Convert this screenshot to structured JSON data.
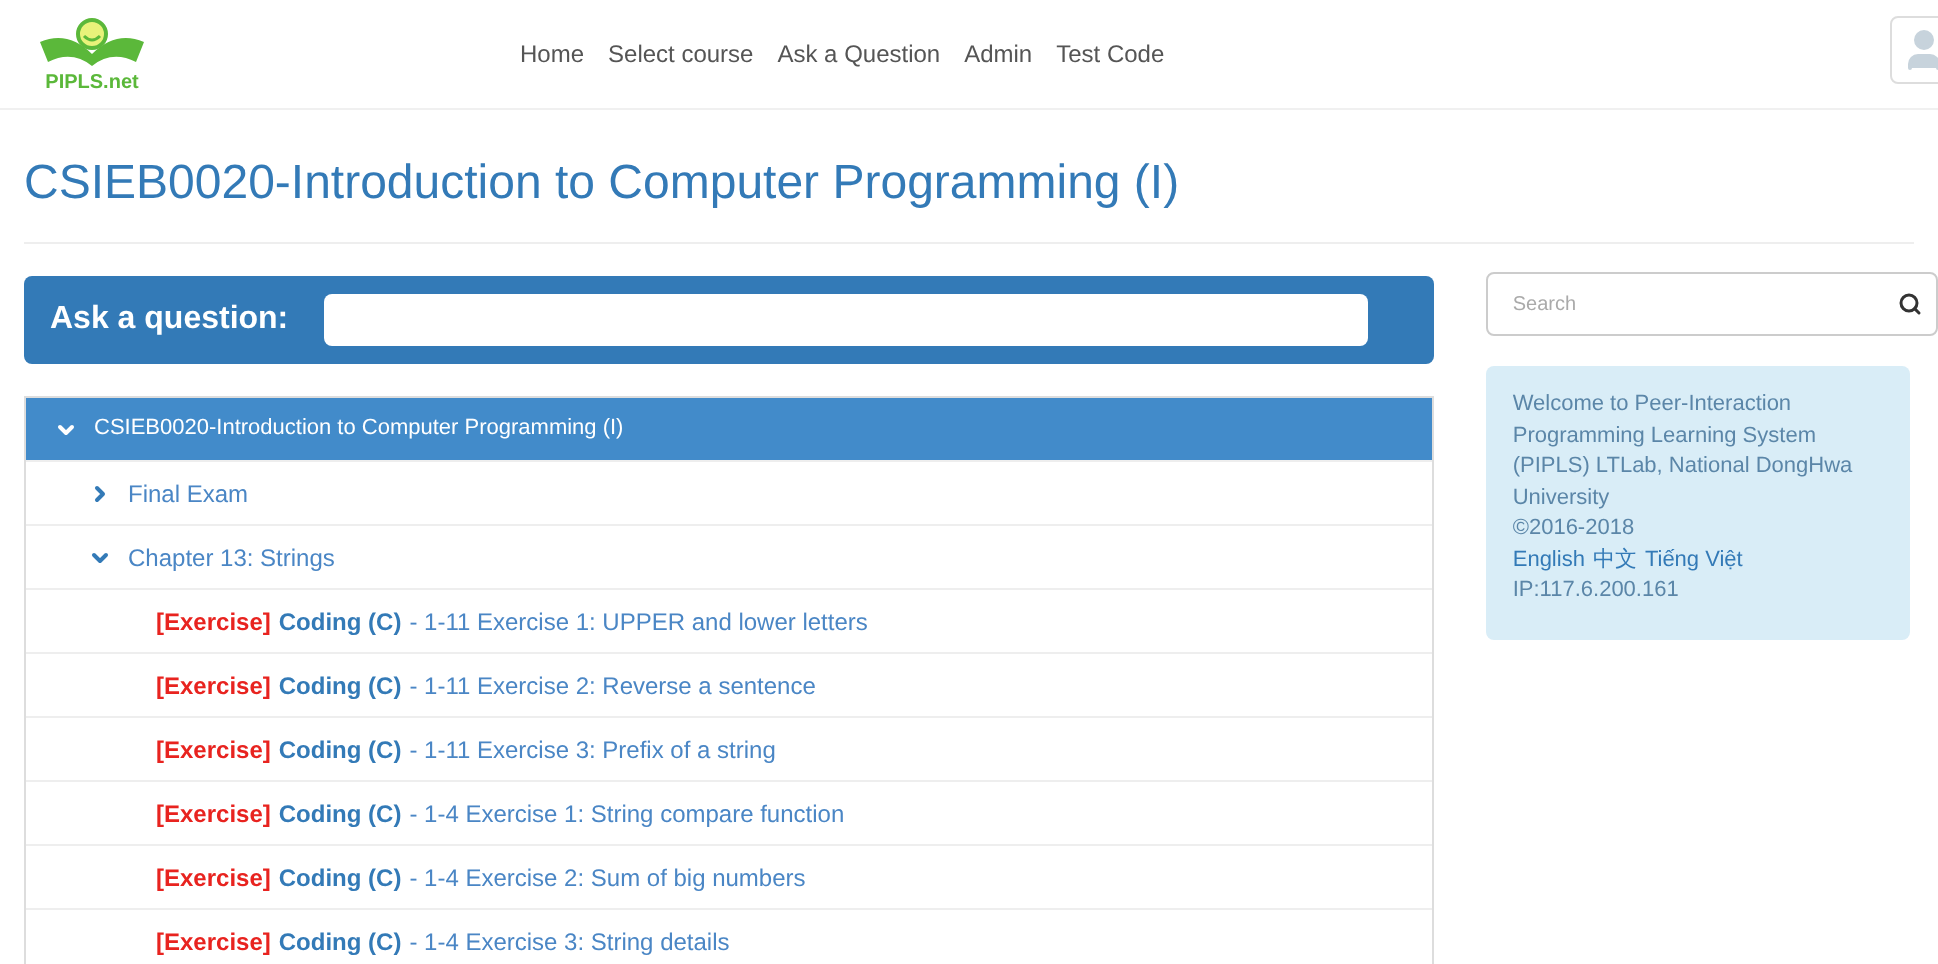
{
  "logo": {
    "text": "PIPLS.net"
  },
  "nav": [
    "Home",
    "Select course",
    "Ask a Question",
    "Admin",
    "Test Code"
  ],
  "page_title": "CSIEB0020-Introduction to Computer Programming (I)",
  "ask": {
    "label": "Ask a question:"
  },
  "tree": {
    "label": "CSIEB0020-Introduction to Computer Programming (I)",
    "expanded": true,
    "children": [
      {
        "label": "Final Exam",
        "expanded": false
      },
      {
        "label": "Chapter 13: Strings",
        "expanded": true,
        "children": [
          {
            "tag": "[Exercise]",
            "type": "Coding (C)",
            "title": "- 1-11 Exercise 1: UPPER and lower letters"
          },
          {
            "tag": "[Exercise]",
            "type": "Coding (C)",
            "title": "- 1-11 Exercise 2: Reverse a sentence"
          },
          {
            "tag": "[Exercise]",
            "type": "Coding (C)",
            "title": "- 1-11 Exercise 3: Prefix of a string"
          },
          {
            "tag": "[Exercise]",
            "type": "Coding (C)",
            "title": "- 1-4 Exercise 1: String compare function"
          },
          {
            "tag": "[Exercise]",
            "type": "Coding (C)",
            "title": "- 1-4 Exercise 2: Sum of big numbers"
          },
          {
            "tag": "[Exercise]",
            "type": "Coding (C)",
            "title": "- 1-4 Exercise 3: String details"
          }
        ]
      }
    ]
  },
  "search": {
    "placeholder": "Search"
  },
  "info": {
    "welcome": "Welcome to Peer-Interaction Programming Learning System (PIPLS) LTLab, National DongHwa University",
    "copyright": "©2016-2018",
    "languages": [
      "English",
      "中文",
      "Tiếng Việt"
    ],
    "ip": "IP:117.6.200.161"
  }
}
